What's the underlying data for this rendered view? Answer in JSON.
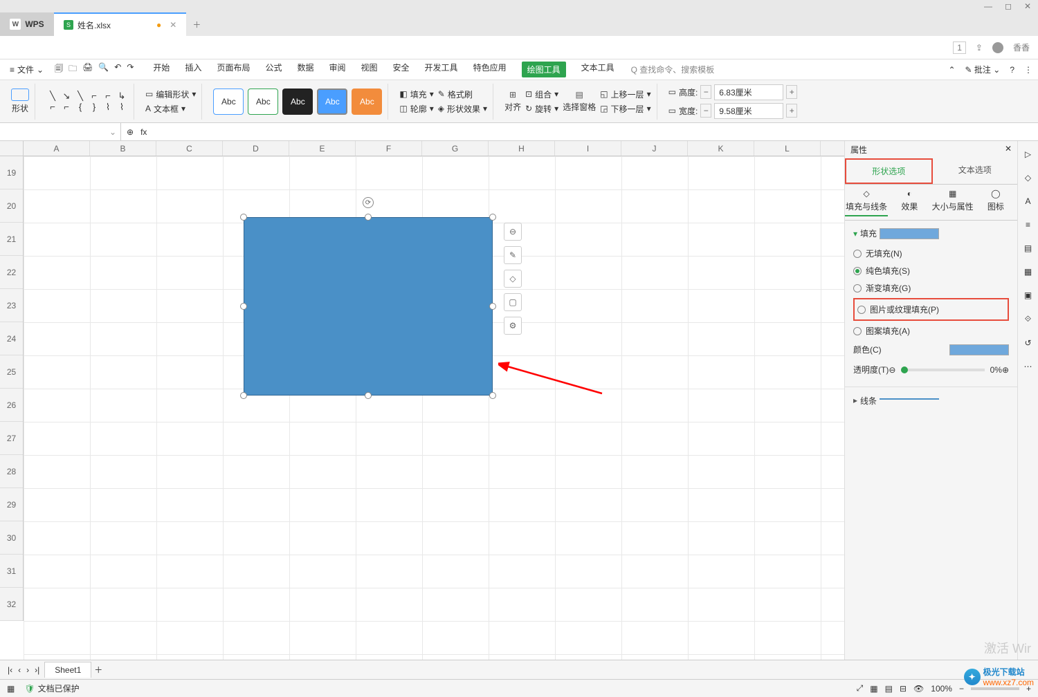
{
  "window": {
    "minimize": "—",
    "maximize": "◻",
    "close": "✕"
  },
  "app": {
    "logo": "W",
    "name": "WPS"
  },
  "file_tab": {
    "icon": "S",
    "name": "姓名.xlsx",
    "dirty": "●",
    "close": "✕",
    "add": "＋"
  },
  "userbar": {
    "badge": "1",
    "user": "香香"
  },
  "menu": {
    "hamburger": "≡",
    "file": "文件",
    "drop": "⌄",
    "items": [
      "开始",
      "插入",
      "页面布局",
      "公式",
      "数据",
      "审阅",
      "视图",
      "安全",
      "开发工具",
      "特色应用",
      "绘图工具",
      "文本工具"
    ],
    "search": "Q 查找命令、搜索模板",
    "annotate": "批注",
    "help": "?",
    "more": "⋮"
  },
  "ribbon": {
    "shape_btn": "形状",
    "edit_shape": "编辑形状",
    "text_box": "文本框",
    "abc": [
      "Abc",
      "Abc",
      "Abc",
      "Abc",
      "Abc"
    ],
    "fill": "填充",
    "format_painter": "格式刷",
    "outline": "轮廓",
    "shape_effect": "形状效果",
    "align": "对齐",
    "group": "组合",
    "rotate": "旋转",
    "sel_pane": "选择窗格",
    "move_up": "上移一层",
    "move_down": "下移一层",
    "height_l": "高度:",
    "height_v": "6.83厘米",
    "width_l": "宽度:",
    "width_v": "9.58厘米",
    "minus": "−",
    "plus": "+"
  },
  "formula": {
    "fx": "fx",
    "zoom": "⊕",
    "drop": "⌄"
  },
  "cols": [
    "A",
    "B",
    "C",
    "D",
    "E",
    "F",
    "G",
    "H",
    "I",
    "J",
    "K",
    "L"
  ],
  "rows": [
    "19",
    "20",
    "21",
    "22",
    "23",
    "24",
    "25",
    "26",
    "27",
    "28",
    "29",
    "30",
    "31",
    "32"
  ],
  "float_tools": [
    "⊖",
    "✎",
    "◇",
    "▢",
    "⚙"
  ],
  "panel": {
    "title": "属性",
    "close": "✕",
    "tab_shape": "形状选项",
    "tab_text": "文本选项",
    "sub": {
      "fill": "填充与线条",
      "effect": "效果",
      "size": "大小与属性",
      "icon": "图标"
    },
    "sec_fill": "填充",
    "r_none": "无填充(N)",
    "r_solid": "纯色填充(S)",
    "r_grad": "渐变填充(G)",
    "r_pic": "图片或纹理填充(P)",
    "r_pattern": "图案填充(A)",
    "color": "颜色(C)",
    "opacity": "透明度(T)",
    "opacity_v": "0%",
    "sec_line": "线条"
  },
  "sheet": {
    "name": "Sheet1",
    "add": "＋"
  },
  "status": {
    "protect": "文档已保护",
    "zoom": "100%",
    "minus": "−",
    "plus": "+",
    "watermark": "激活 Wir",
    "site": "极光下载站",
    "url": "www.xz7.com"
  }
}
